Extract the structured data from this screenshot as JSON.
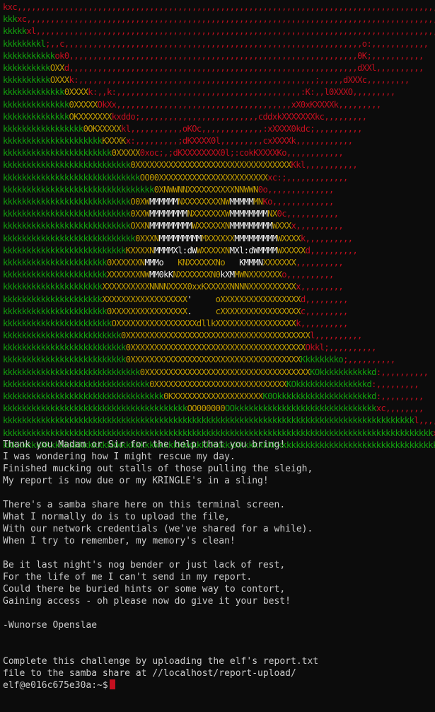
{
  "colors": {
    "background": "#0c0c0c",
    "text": "#cccccc",
    "g": "#13a10e",
    "r": "#c50f1f",
    "y": "#c19c00",
    "w": "#f2f2f2",
    "cursor": "#c50f1f"
  },
  "art": [
    [
      [
        "r",
        "kxc,,,,,,,,,,,,,,,,,,,,,,,,,,,,,,,,,,,,,,,,,,,,,,,,,,,,,,,,,,,,,,,,,,,,,,,,,,,,,,,,,,,,,,,,,,,,,,,,"
      ]
    ],
    [
      [
        "g",
        "kkk"
      ],
      [
        "r",
        "xc,,,,,,,,,,,,,,,,,,,,,,,,,,,,,,,,,,,,,,,,,,,,,,,,,,,,,,,,,,,,,,,,,,,,,,,,,,,,,,,,,,,,,,,,,,,,,"
      ]
    ],
    [
      [
        "g",
        "kkkkk"
      ],
      [
        "r",
        "xl,,,,,,,,,,,,,,,,,,,,,,,,,,,,,,,,,,,,,,,,,,,,,,,,,,,,,,,,,,,,,,,,,,,,,,,,,,,,,,,,,,,,,,,,,,"
      ]
    ],
    [
      [
        "g",
        "kkkkkkkkl"
      ],
      [
        "r",
        ";,,c,,,,,,,,,,,,,,,,,,,,,,,,,,,,,,,,,,,,,,,,,,,,,,,,,,,,,,,,,,,,,,,o:,,,,,,,,,,,,"
      ]
    ],
    [
      [
        "g",
        "kkkkkkkkkkk"
      ],
      [
        "r",
        "ok0,,,,,,,,,,,,,,,,,,,,,,,,,,,,,,,,,,,,,,,,,,,,,,,,,,,,,,,,,,,,,0K;,,,,,,,,,,,"
      ]
    ],
    [
      [
        "g",
        "kkkkkkkkkk"
      ],
      [
        "y",
        "OXX"
      ],
      [
        "r",
        "d,,,,,,,,,,,,,,,,,,,,,,,,,,,,,,,,,,,,,,,,,,,,,,,,,,,,,,,,,,,,,dXXl,,,,,,,,,,"
      ]
    ],
    [
      [
        "g",
        "kkkkkkkkkk"
      ],
      [
        "y",
        "OXXX"
      ],
      [
        "r",
        "k:,,,,,,,,,,,,,,,,,,,,,,,,,,,,,,,,,,,,,,,,,,,,,,,,,,;,,,,,dXXXc,,,,,,,,,"
      ]
    ],
    [
      [
        "g",
        "kkkkkkkkkkkkk"
      ],
      [
        "y",
        "0XXXX"
      ],
      [
        "r",
        "k:,,k:,,,,,,,,,,,,,,,,,,,,,,,,,,,,,,,,,,,,,,,:K:,,l0XXXO,,,,,,,,,"
      ]
    ],
    [
      [
        "g",
        "kkkkkkkkkkkkkk"
      ],
      [
        "y",
        "0XXXXX"
      ],
      [
        "r",
        "OkXx,,,,,,,,,,,,,,,,,,,,,,,,,,,,,,,,,,,,,xX0xKXXXXk,,,,,,,,,"
      ]
    ],
    [
      [
        "g",
        "kkkkkkkkkkkkkk"
      ],
      [
        "y",
        "OKXXXXXXX"
      ],
      [
        "r",
        "kxddo;,,,,,,,,,,,,,,,,,,,,,,,,,cddxkXXXXXXXkc,,,,,,,,,"
      ]
    ],
    [
      [
        "g",
        "kkkkkkkkkkkkkkkkk"
      ],
      [
        "y",
        "0OKXXXXX"
      ],
      [
        "r",
        "kl,,,,,,,,,,,oKOc,,,,,,,,,,,,,:xXXXX0kdc;,,,,,,,,,,"
      ]
    ],
    [
      [
        "g",
        "kkkkkkkkkkkkkkkkkkkkk"
      ],
      [
        "y",
        "KXXXK"
      ],
      [
        "r",
        "x:,,,,,,,,,;dKXXXX0l,,,,,,,,,cxXXXXk,,,,,,,,,,,,"
      ]
    ],
    [
      [
        "g",
        "kkkkkkkkkkkkkkkkkkkkkkk"
      ],
      [
        "y",
        "0XXXXX"
      ],
      [
        "r",
        "0xoc;,;dKXXXXXXXX0l;:cokKXXXXKo,,,,,,,,,,,,"
      ]
    ],
    [
      [
        "g",
        "kkkkkkkkkkkkkkkkkkkkkkkkkkk"
      ],
      [
        "y",
        "0XXXXXXXXXXXXXXXXXXXXXXXXXXXXXXXXX"
      ],
      [
        "r",
        "Kkl,,,,,,,,,,,"
      ]
    ],
    [
      [
        "g",
        "kkkkkkkkkkkkkkkkkkkkkkkkkkkkk"
      ],
      [
        "y",
        "OO00XXXXXXXXXXXXXXXXXXXXXXX"
      ],
      [
        "r",
        "xc:;,,,,,,,,,,,,,"
      ]
    ],
    [
      [
        "g",
        "kkkkkkkkkkkkkkkkkkkkkkkkkkkkkkkk"
      ],
      [
        "y",
        "0XNWWNNXXXXXXXXXXNNWWN"
      ],
      [
        "r",
        "0o,,,,,,,,,,,,,,"
      ]
    ],
    [
      [
        "g",
        "kkkkkkkkkkkkkkkkkkkkkkkkkkk"
      ],
      [
        "y",
        "O0XW"
      ],
      [
        "w",
        "MMMMMM"
      ],
      [
        "y",
        "NXXXXXXXXNW"
      ],
      [
        "w",
        "MMMMM"
      ],
      [
        "y",
        "MN"
      ],
      [
        "r",
        "Ko,,,,,,,,,,,,,"
      ]
    ],
    [
      [
        "g",
        "kkkkkkkkkkkkkkkkkkkkkkkkkkk"
      ],
      [
        "y",
        "0XXW"
      ],
      [
        "w",
        "MMMMMMMM"
      ],
      [
        "y",
        "NXXXXXXXW"
      ],
      [
        "w",
        "MMMMMMMM"
      ],
      [
        "y",
        "NX"
      ],
      [
        "r",
        "0c,,,,,,,,,,,"
      ]
    ],
    [
      [
        "g",
        "kkkkkkkkkkkkkkkkkkkkkkkkkkk"
      ],
      [
        "y",
        "OXXN"
      ],
      [
        "w",
        "MMMMMMMMM"
      ],
      [
        "y",
        "WXXXXXXN"
      ],
      [
        "w",
        "MMMMMMMMM"
      ],
      [
        "y",
        "WXXX"
      ],
      [
        "r",
        "x,,,,,,,,,,"
      ]
    ],
    [
      [
        "g",
        "kkkkkkkkkkkkkkkkkkkkkkkkkkkk"
      ],
      [
        "y",
        "0XXXN"
      ],
      [
        "w",
        "MMMMMMMMM"
      ],
      [
        "y",
        "MXXXXXX"
      ],
      [
        "w",
        "MMMMMMMMM"
      ],
      [
        "y",
        "WXXXX"
      ],
      [
        "r",
        "k,,,,,,,,,,"
      ]
    ],
    [
      [
        "g",
        "kkkkkkkkkkkkkkkkkkkkkkkkkk"
      ],
      [
        "y",
        "KXXXXN"
      ],
      [
        "w",
        "MMMMXl:dW"
      ],
      [
        "y",
        "WXXXXXN"
      ],
      [
        "w",
        "MXl:dWMMMM"
      ],
      [
        "y",
        "WXXXXX"
      ],
      [
        "r",
        "d,,,,,,,,,,"
      ]
    ],
    [
      [
        "g",
        "kkkkkkkkkkkkkkkkkkkkkk"
      ],
      [
        "y",
        "0XXXXXXN"
      ],
      [
        "w",
        "MMMo   "
      ],
      [
        "y",
        "KNXXXXXXNo   "
      ],
      [
        "w",
        "KMMMN"
      ],
      [
        "y",
        "XXXXXXX"
      ],
      [
        "r",
        ",,,,,,,,,,"
      ]
    ],
    [
      [
        "g",
        "kkkkkkkkkkkkkkkkkkkkkk"
      ],
      [
        "y",
        "XXXXXXXNW"
      ],
      [
        "w",
        "MM0kK"
      ],
      [
        "y",
        "NXXXXXXXN0"
      ],
      [
        "w",
        "kXM"
      ],
      [
        "y",
        "MWNXXXXXXX"
      ],
      [
        "r",
        "o,,,,,,,,,,"
      ]
    ],
    [
      [
        "g",
        "kkkkkkkkkkkkkkkkkkkkk"
      ],
      [
        "y",
        "XXXXXXXXXXNNNNXXXX0xxKXXXXXNNNNXXXXXXXXXX"
      ],
      [
        "r",
        "x,,,,,,,,,"
      ]
    ],
    [
      [
        "g",
        "kkkkkkkkkkkkkkkkkkkkk"
      ],
      [
        "y",
        "XXXXXXXXXXXXXXXXXX"
      ],
      [
        "w",
        "'     "
      ],
      [
        "y",
        "oXXXXXXXXXXXXXXXXX"
      ],
      [
        "r",
        "d,,,,,,,,,"
      ]
    ],
    [
      [
        "g",
        "kkkkkkkkkkkkkkkkkkkkkk"
      ],
      [
        "y",
        "0XXXXXXXXXXXXXXXX"
      ],
      [
        "w",
        ".     "
      ],
      [
        "y",
        "cXXXXXXXXXXXXXXXXX"
      ],
      [
        "r",
        "c,,,,,,,,,"
      ]
    ],
    [
      [
        "g",
        "kkkkkkkkkkkkkkkkkkkkkkk"
      ],
      [
        "y",
        "OXXXXXXXXXXXXXXXXXdllkXXXXXXXXXXXXXXXXX"
      ],
      [
        "r",
        "k,,,,,,,,,,"
      ]
    ],
    [
      [
        "g",
        "kkkkkkkkkkkkkkkkkkkkkkkkk"
      ],
      [
        "y",
        "0XXXXXXXXXXXXXXXXXXXXXXXXXXXXXXXXXXXXXXX"
      ],
      [
        "r",
        "l,,,,,,,,,,"
      ]
    ],
    [
      [
        "g",
        "kkkkkkkkkkkkkkkkkkkkkkkkkk"
      ],
      [
        "y",
        "0XXXXXXXXXXXXXXXXXXXXXXXXXXXXXXXXXXXXX"
      ],
      [
        "r",
        "Okkl;,,,,,,,,,,"
      ]
    ],
    [
      [
        "g",
        "kkkkkkkkkkkkkkkkkkkkkkkkkk"
      ],
      [
        "y",
        "0XXXXXXXXXXXXXXXXXXXXXXXXXXXXXXXXXXXX"
      ],
      [
        "g",
        "Kkkkkkkko"
      ],
      [
        "r",
        ";,,,,,,,,,,"
      ]
    ],
    [
      [
        "g",
        "kkkkkkkkkkkkkkkkkkkkkkkkkkkkk"
      ],
      [
        "y",
        "0XXXXXXXXXXXXXXXXXXXXXXXXXXXXXXXXXXX"
      ],
      [
        "g",
        "KOkkkkkkkkkkkd"
      ],
      [
        "r",
        ":,,,,,,,,,,"
      ]
    ],
    [
      [
        "g",
        "kkkkkkkkkkkkkkkkkkkkkkkkkkkkkkk"
      ],
      [
        "y",
        "0XXXXXXXXXXXXXXXXXXXXXXXXXXXX"
      ],
      [
        "g",
        "KOkkkkkkkkkkkkkkkd"
      ],
      [
        "r",
        ":,,,,,,,,,"
      ]
    ],
    [
      [
        "g",
        "kkkkkkkkkkkkkkkkkkkkkkkkkkkkkkkkkk"
      ],
      [
        "y",
        "0KXXXXXXXXXXXXXXXXXXX"
      ],
      [
        "g",
        "K0Okkkkkkkkkkkkkkkkkkkkd"
      ],
      [
        "r",
        ":,,,,,,,,,"
      ]
    ],
    [
      [
        "g",
        "kkkkkkkkkkkkkkkkkkkkkkkkkkkkkkkkkkkkkkk"
      ],
      [
        "y",
        "OO000000"
      ],
      [
        "g",
        "OOkkkkkkkkkkkkkkkkkkkkkkkkkkkkkk"
      ],
      [
        "r",
        "xc,,,,,,,,"
      ]
    ],
    [
      [
        "g",
        "kkkkkkkkkkkkkkkkkkkkkkkkkkkkkkkkkkkkkkkkkkkkkkkkkkkkkkkkkkkkkkkkkkkkkkkkkkkkkkkkkkkkkkk"
      ],
      [
        "r",
        "l,,,,,,,,"
      ]
    ],
    [
      [
        "g",
        "kkkkkkkkkkkkkkkkkkkkkkkkkkkkkkkkkkkkkkkkkkkkkkkkkkkkkkkkkkkkkkkkkkkkkkkkkkkkkkkkkkkkkkkkkkk"
      ],
      [
        "r",
        "xl,,,,"
      ]
    ],
    [
      [
        "g",
        "kkkkkkkkkkkkkkkkkkkkkkkkkkkkkkkkkkkkkkkkkkkkkkkkkkkkkkkkkkkkkkkkkkkkkkkkkkkkkkkkkkkkkkkkkkkkkkkk"
      ],
      [
        "r",
        "x;"
      ]
    ]
  ],
  "poem": [
    "Thank you Madam or Sir for the help that you bring!",
    "I was wondering how I might rescue my day.",
    "Finished mucking out stalls of those pulling the sleigh,",
    "My report is now due or my KRINGLE's in a sling!",
    "",
    "There's a samba share here on this terminal screen.",
    "What I normally do is to upload the file,",
    "With our network credentials (we've shared for a while).",
    "When I try to remember, my memory's clean!",
    "",
    "Be it last night's nog bender or just lack of rest,",
    "For the life of me I can't send in my report.",
    "Could there be buried hints or some way to contort,",
    "Gaining access - oh please now do give it your best!",
    "",
    "-Wunorse Openslae",
    "",
    "",
    "Complete this challenge by uploading the elf's report.txt",
    "file to the samba share at //localhost/report-upload/"
  ],
  "prompt": "elf@e016c675e30a:~$"
}
